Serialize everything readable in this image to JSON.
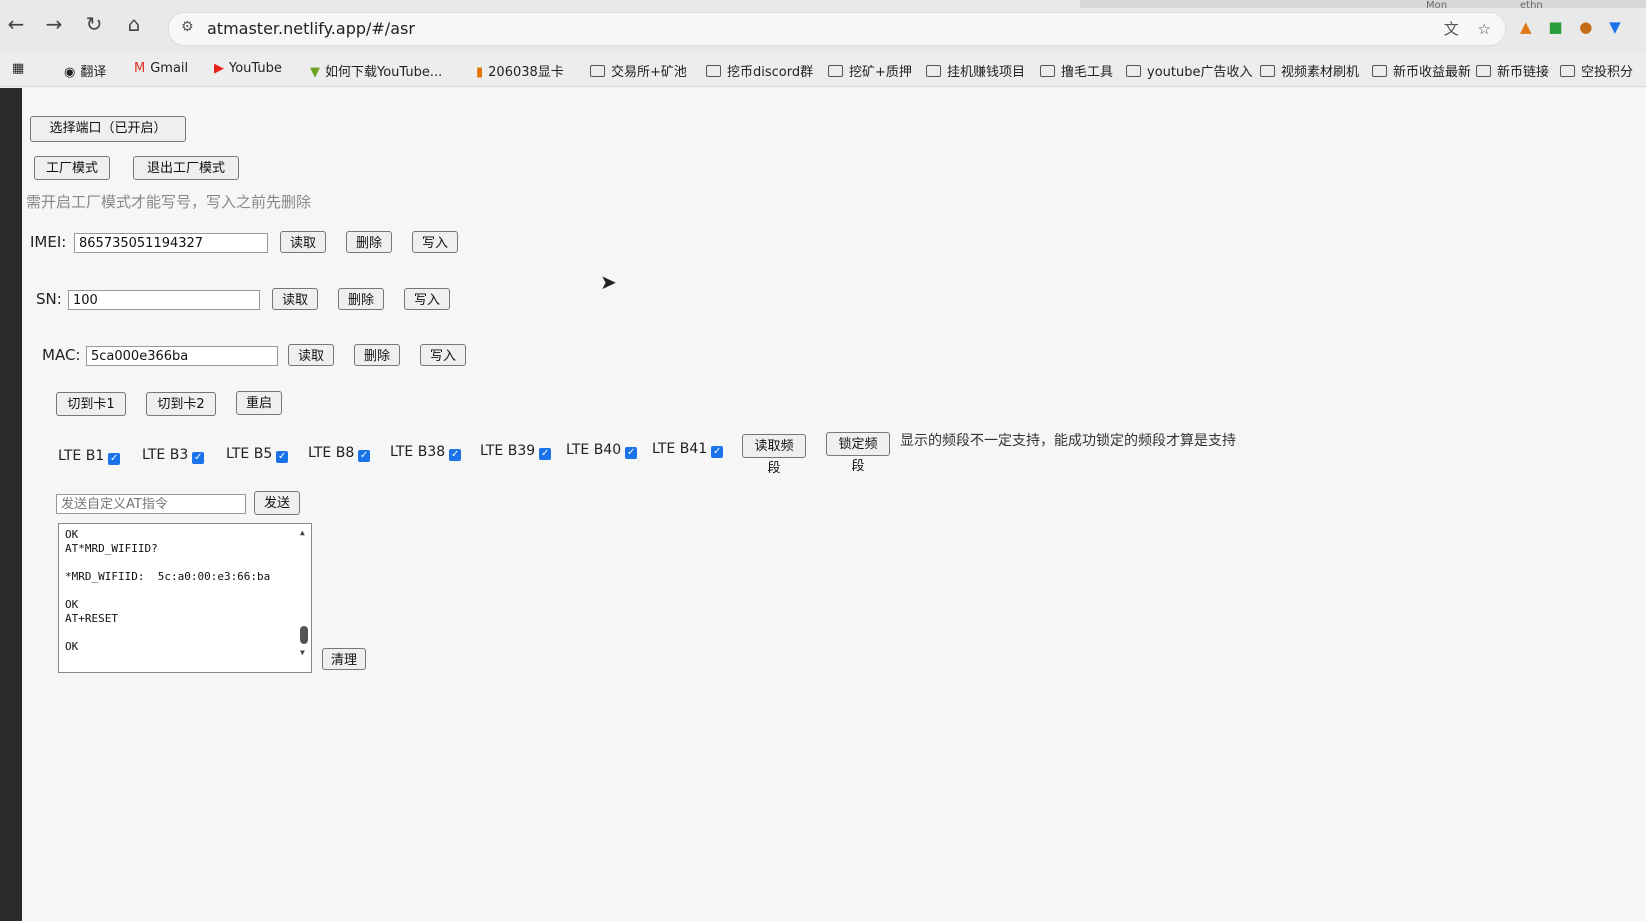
{
  "browser": {
    "url": "atmaster.netlify.app/#/asr",
    "tabs_glimpse": [
      "Mon",
      "ethn"
    ]
  },
  "bookmarks": [
    {
      "icon": "apps-grid-icon",
      "label": ""
    },
    {
      "icon": "translate-icon",
      "label": "翻译"
    },
    {
      "icon": "gmail-icon",
      "label": "Gmail"
    },
    {
      "icon": "youtube-icon",
      "label": "YouTube"
    },
    {
      "icon": "download-icon",
      "label": "如何下载YouTube..."
    },
    {
      "icon": "site-icon",
      "label": "206038显卡"
    },
    {
      "icon": "folder-icon",
      "label": "交易所+矿池"
    },
    {
      "icon": "folder-icon",
      "label": "挖币discord群"
    },
    {
      "icon": "folder-icon",
      "label": "挖矿+质押"
    },
    {
      "icon": "folder-icon",
      "label": "挂机赚钱项目"
    },
    {
      "icon": "folder-icon",
      "label": "撸毛工具"
    },
    {
      "icon": "folder-icon",
      "label": "youtube广告收入"
    },
    {
      "icon": "folder-icon",
      "label": "视频素材刷机"
    },
    {
      "icon": "folder-icon",
      "label": "新币收益最新"
    },
    {
      "icon": "folder-icon",
      "label": "新币链接"
    },
    {
      "icon": "folder-icon",
      "label": "空投积分"
    }
  ],
  "app": {
    "select_port_label": "选择端口（已开启）",
    "factory_mode_label": "工厂模式",
    "exit_factory_mode_label": "退出工厂模式",
    "hint": "需开启工厂模式才能写号，写入之前先删除",
    "read_label": "读取",
    "delete_label": "删除",
    "write_label": "写入",
    "imei": {
      "label": "IMEI:",
      "value": "865735051194327"
    },
    "sn": {
      "label": "SN:",
      "value": "100"
    },
    "mac": {
      "label": "MAC:",
      "value": "5ca000e366ba"
    },
    "switch_card1_label": "切到卡1",
    "switch_card2_label": "切到卡2",
    "reboot_label": "重启",
    "bands": [
      {
        "label": "LTE B1",
        "checked": true
      },
      {
        "label": "LTE B3",
        "checked": true
      },
      {
        "label": "LTE B5",
        "checked": true
      },
      {
        "label": "LTE B8",
        "checked": true
      },
      {
        "label": "LTE B38",
        "checked": true
      },
      {
        "label": "LTE B39",
        "checked": true
      },
      {
        "label": "LTE B40",
        "checked": true
      },
      {
        "label": "LTE B41",
        "checked": true
      }
    ],
    "read_bands_label": "读取频段",
    "lock_bands_label": "锁定频段",
    "bands_note": "显示的频段不一定支持，能成功锁定的频段才算是支持",
    "at_input_placeholder": "发送自定义AT指令",
    "send_label": "发送",
    "console_text": "OK\nAT*MRD_WIFIID?\n\n*MRD_WIFIID:  5c:a0:00:e3:66:ba\n\nOK\nAT+RESET\n\nOK",
    "clear_label": "清理"
  }
}
